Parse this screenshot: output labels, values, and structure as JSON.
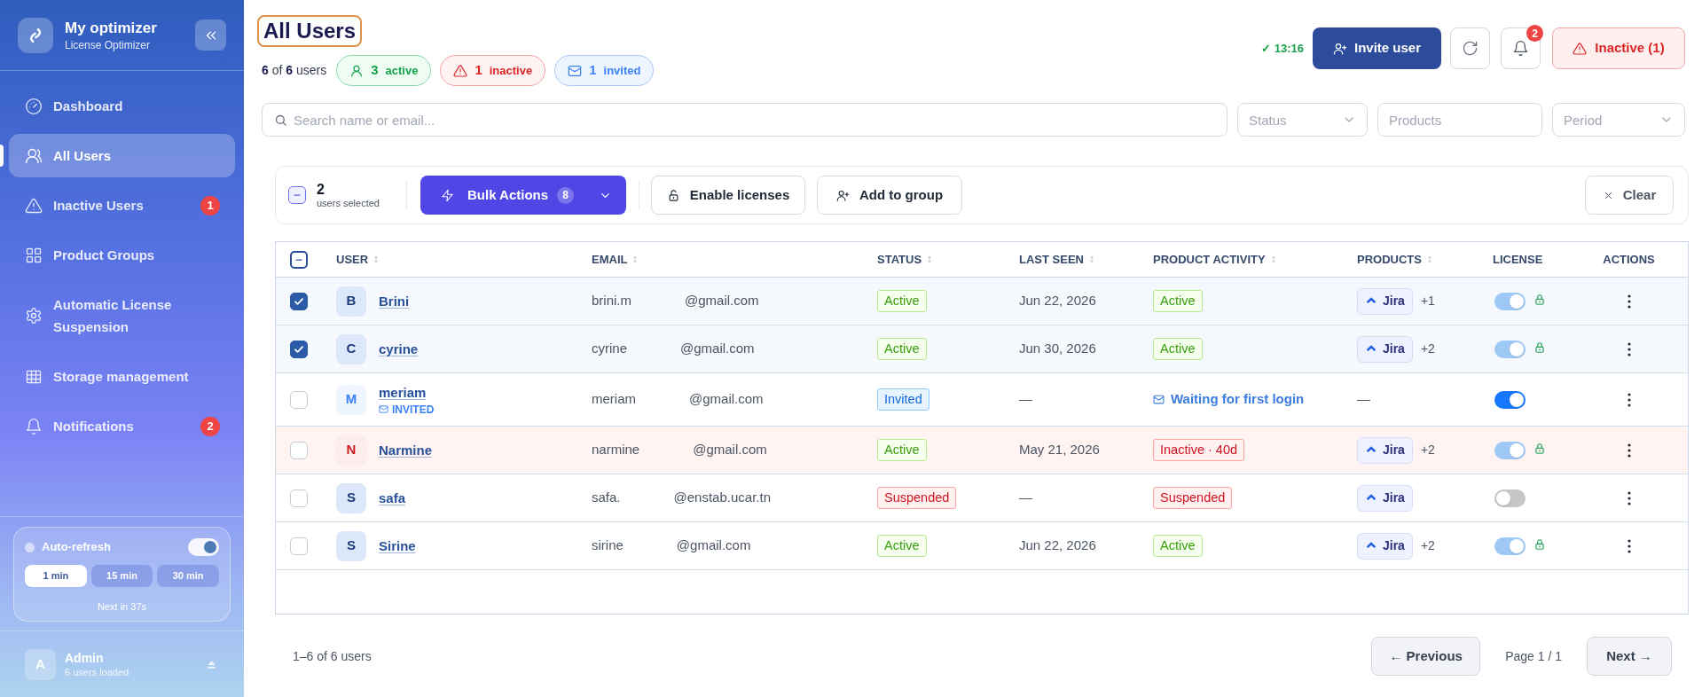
{
  "sidebar": {
    "title": "My optimizer",
    "subtitle": "License Optimizer",
    "items": [
      {
        "label": "Dashboard",
        "selected": false
      },
      {
        "label": "All Users",
        "selected": true
      },
      {
        "label": "Inactive Users",
        "selected": false,
        "badge": "1"
      },
      {
        "label": "Product Groups",
        "selected": false
      },
      {
        "label": "Automatic License Suspension",
        "selected": false
      },
      {
        "label": "Storage management",
        "selected": false
      },
      {
        "label": "Notifications",
        "selected": false,
        "badge": "2"
      }
    ],
    "auto_refresh": {
      "label": "Auto-refresh",
      "on": true,
      "intervals": [
        {
          "label": "1 min",
          "selected": true
        },
        {
          "label": "15 min",
          "selected": false
        },
        {
          "label": "30 min",
          "selected": false
        }
      ],
      "next": "Next in 37s"
    },
    "account": {
      "initial": "A",
      "name": "Admin",
      "detail": "6 users loaded"
    }
  },
  "header": {
    "title": "All Users",
    "count": "**6** of **6** users",
    "pills": [
      {
        "kind": "active",
        "count": "3",
        "label": "active"
      },
      {
        "kind": "inactive",
        "count": "1",
        "label": "inactive"
      },
      {
        "kind": "invited",
        "count": "1",
        "label": "invited"
      }
    ],
    "sync": "✓ 13:16",
    "invite_button": "Invite user",
    "notification_badge": "2",
    "alert_button": "Inactive (1)"
  },
  "filters": {
    "search_placeholder": "Search name or email...",
    "fields": [
      {
        "kind": "select",
        "placeholder": "Status"
      },
      {
        "kind": "input",
        "placeholder": "Products"
      },
      {
        "kind": "select",
        "placeholder": "Period"
      }
    ]
  },
  "bulk_bar": {
    "select_all": {
      "checked": false,
      "indeterminate": true
    },
    "count": "2",
    "count_label": "users selected",
    "buttons": [
      {
        "kind": "primary",
        "label": "Bulk Actions",
        "badge": "8"
      },
      {
        "kind": "outline",
        "label": "Enable licenses"
      },
      {
        "kind": "outline",
        "label": "Add to group"
      }
    ],
    "clear_button": "Clear"
  },
  "table": {
    "select_all": {
      "checked": false,
      "indeterminate": true
    },
    "columns": [
      {
        "label": "USER",
        "sortable": true
      },
      {
        "label": "EMAIL",
        "sortable": true
      },
      {
        "label": "STATUS",
        "sortable": true
      },
      {
        "label": "LAST SEEN",
        "sortable": true
      },
      {
        "label": "PRODUCT ACTIVITY",
        "sortable": true
      },
      {
        "label": "PRODUCTS",
        "sortable": true
      },
      {
        "label": "LICENSE",
        "sortable": false
      },
      {
        "label": "ACTIONS",
        "sortable": false
      }
    ],
    "rows": [
      {
        "selected": true,
        "kind": "normal",
        "initial": "B",
        "name": "Brini",
        "email": [
          "brini.m",
          "@gmail.com"
        ],
        "status": {
          "kind": "active",
          "label": "Active"
        },
        "last_seen": "Jun 22, 2026",
        "activity": {
          "kind": "active",
          "label": "Active"
        },
        "products": {
          "kind": "chip",
          "label": "Jira",
          "more": "+1"
        },
        "license": {
          "on": true,
          "locked": true
        }
      },
      {
        "selected": true,
        "kind": "normal",
        "initial": "C",
        "name": "cyrine",
        "email": [
          "cyrine",
          "@gmail.com"
        ],
        "status": {
          "kind": "active",
          "label": "Active"
        },
        "last_seen": "Jun 30, 2026",
        "activity": {
          "kind": "active",
          "label": "Active"
        },
        "products": {
          "kind": "chip",
          "label": "Jira",
          "more": "+2"
        },
        "license": {
          "on": true,
          "locked": true
        }
      },
      {
        "selected": false,
        "kind": "invited",
        "initial": "M",
        "name": "meriam",
        "tag": "INVITED",
        "email": [
          "meriam",
          "@gmail.com"
        ],
        "status": {
          "kind": "invited",
          "label": "Invited"
        },
        "last_seen": "—",
        "activity": {
          "kind": "invited",
          "label": "Waiting for first login"
        },
        "products": {
          "kind": "none",
          "label": "—"
        },
        "license": {
          "on": true,
          "locked": false
        }
      },
      {
        "selected": false,
        "kind": "inactive",
        "initial": "N",
        "name": "Narmine",
        "email": [
          "narmine",
          "@gmail.com"
        ],
        "status": {
          "kind": "active",
          "label": "Active"
        },
        "last_seen": "May 21, 2026",
        "activity": {
          "kind": "inactive",
          "label": "Inactive · 40d"
        },
        "products": {
          "kind": "chip",
          "label": "Jira",
          "more": "+2"
        },
        "license": {
          "on": true,
          "locked": true
        }
      },
      {
        "selected": false,
        "kind": "normal",
        "initial": "S",
        "name": "safa",
        "email": [
          "safa.",
          "@enstab.ucar.tn"
        ],
        "status": {
          "kind": "suspended",
          "label": "Suspended"
        },
        "last_seen": "—",
        "activity": {
          "kind": "suspended",
          "label": "Suspended"
        },
        "products": {
          "kind": "chip",
          "label": "Jira"
        },
        "license": {
          "on": false,
          "locked": false
        }
      },
      {
        "selected": false,
        "kind": "normal",
        "initial": "S",
        "name": "Sirine",
        "email": [
          "sirine",
          "@gmail.com"
        ],
        "status": {
          "kind": "active",
          "label": "Active"
        },
        "last_seen": "Jun 22, 2026",
        "activity": {
          "kind": "active",
          "label": "Active"
        },
        "products": {
          "kind": "chip",
          "label": "Jira",
          "more": "+2"
        },
        "license": {
          "on": true,
          "locked": true
        }
      }
    ]
  },
  "pagination": {
    "range": "1–6 of 6 users",
    "previous": "← Previous",
    "page": "Page 1 / 1",
    "next": "Next →"
  }
}
